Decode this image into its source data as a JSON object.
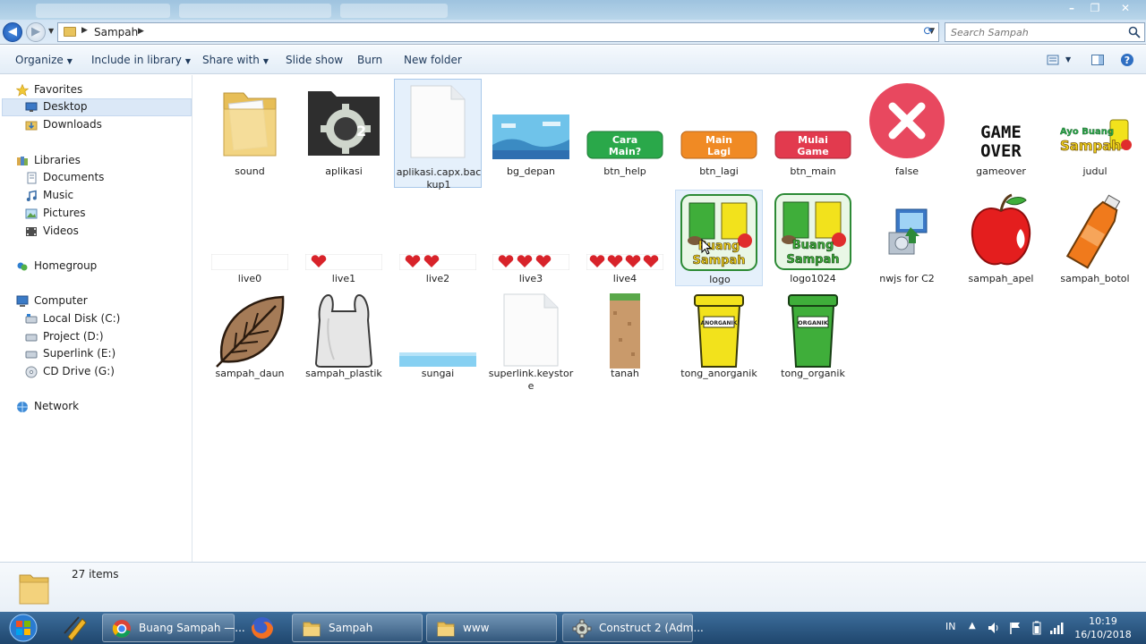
{
  "window": {
    "address": {
      "crumb": "Sampah"
    },
    "search": {
      "placeholder": "Search Sampah"
    }
  },
  "toolbar": {
    "organize": "Organize",
    "include_in_library": "Include in library",
    "share_with": "Share with",
    "slide_show": "Slide show",
    "burn": "Burn",
    "new_folder": "New folder"
  },
  "navpane": {
    "favorites": "Favorites",
    "desktop": "Desktop",
    "downloads": "Downloads",
    "libraries": "Libraries",
    "documents": "Documents",
    "music": "Music",
    "pictures": "Pictures",
    "videos": "Videos",
    "homegroup": "Homegroup",
    "computer": "Computer",
    "local_disk": "Local Disk (C:)",
    "project": "Project (D:)",
    "superlink": "Superlink (E:)",
    "cd_drive": "CD Drive (G:)",
    "network": "Network"
  },
  "files": [
    {
      "name": "sound",
      "kind": "folder"
    },
    {
      "name": "aplikasi",
      "kind": "construct-icon"
    },
    {
      "name": "aplikasi.capx.backup1",
      "kind": "blank-file"
    },
    {
      "name": "bg_depan",
      "kind": "image"
    },
    {
      "name": "btn_help",
      "kind": "button-image",
      "text": "Cara Main?",
      "color": "#2aa84a"
    },
    {
      "name": "btn_lagi",
      "kind": "button-image",
      "text": "Main Lagi",
      "color": "#f08a24"
    },
    {
      "name": "btn_main",
      "kind": "button-image",
      "text": "Mulai Game",
      "color": "#e23a4e"
    },
    {
      "name": "false",
      "kind": "x-icon"
    },
    {
      "name": "gameover",
      "kind": "text-image",
      "text": "GAME OVER"
    },
    {
      "name": "judul",
      "kind": "title-image",
      "text": "Ayo Buang Sampah"
    },
    {
      "name": "live0",
      "kind": "hearts",
      "count": 0
    },
    {
      "name": "live1",
      "kind": "hearts",
      "count": 1
    },
    {
      "name": "live2",
      "kind": "hearts",
      "count": 2
    },
    {
      "name": "live3",
      "kind": "hearts",
      "count": 3
    },
    {
      "name": "live4",
      "kind": "hearts",
      "count": 4
    },
    {
      "name": "logo",
      "kind": "logo-image",
      "text": "Buang Sampah"
    },
    {
      "name": "logo1024",
      "kind": "logo-image",
      "text": "Buang Sampah"
    },
    {
      "name": "nwjs for C2",
      "kind": "installer-icon"
    },
    {
      "name": "sampah_apel",
      "kind": "apple"
    },
    {
      "name": "sampah_botol",
      "kind": "bottle"
    },
    {
      "name": "sampah_daun",
      "kind": "leaf"
    },
    {
      "name": "sampah_plastik",
      "kind": "plastic-bag"
    },
    {
      "name": "sungai",
      "kind": "water"
    },
    {
      "name": "superlink.keystore",
      "kind": "blank-file"
    },
    {
      "name": "tanah",
      "kind": "soil"
    },
    {
      "name": "tong_anorganik",
      "kind": "bin",
      "color": "#f2e21c",
      "text": "ANORGANIK"
    },
    {
      "name": "tong_organik",
      "kind": "bin",
      "color": "#3fae3a",
      "text": "ORGANIK"
    }
  ],
  "status": {
    "count": "27 items"
  },
  "taskbar": {
    "chrome": "Buang Sampah —...",
    "explorer1": "Sampah",
    "explorer2": "www",
    "construct": "Construct 2 (Adm...",
    "lang": "IN",
    "time": "10:19",
    "date": "16/10/2018"
  },
  "colors": {
    "selection": "#dbe8f7",
    "accent": "#1e395b",
    "taskbar": "#2c5783"
  }
}
